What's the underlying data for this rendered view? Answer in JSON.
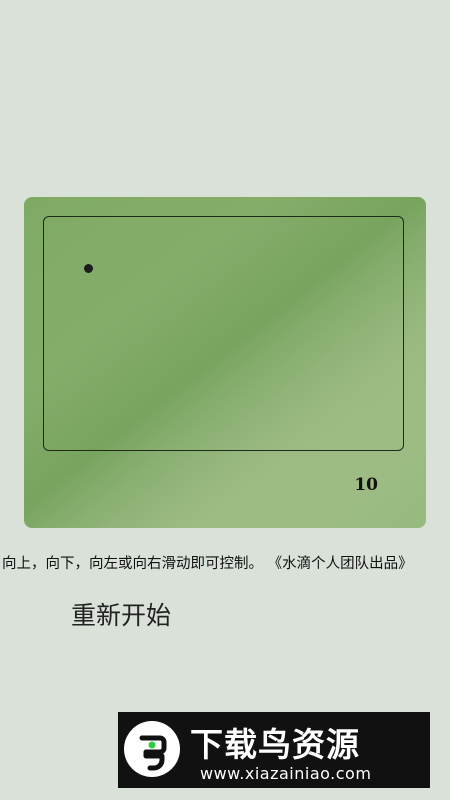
{
  "game": {
    "score": "10"
  },
  "instructions": "向上，向下，向左或向右滑动即可控制。 《水滴个人团队出品》",
  "restart_label": "重新开始",
  "watermark": {
    "title": "下载鸟资源",
    "url": "www.xiazainiao.com"
  },
  "colors": {
    "background": "#d9e1d9",
    "screen": "#7faa64",
    "accent_green": "#2ecc40"
  }
}
